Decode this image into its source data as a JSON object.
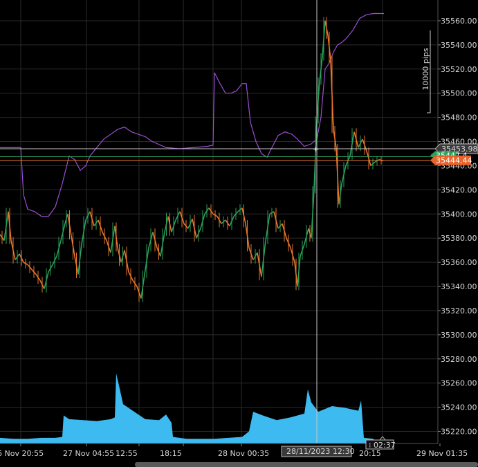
{
  "chart_data": {
    "type": "candlestick",
    "xlabel": "",
    "ylabel": "",
    "ylim": [
      35210,
      35572
    ],
    "y_ticks": [
      35220,
      35240,
      35260,
      35280,
      35300,
      35320,
      35340,
      35360,
      35380,
      35400,
      35420,
      35440,
      35460,
      35480,
      35500,
      35520,
      35540,
      35560
    ],
    "y_tick_labels": [
      "35220.00",
      "35240.00",
      "35260.00",
      "35280.00",
      "35300.00",
      "35320.00",
      "35340.00",
      "35360.00",
      "35380.00",
      "35400.00",
      "35420.00",
      "35440.00",
      "35460.00",
      "35480.00",
      "35500.00",
      "35520.00",
      "35540.00",
      "35560.00"
    ],
    "x_tick_labels": [
      "6 Nov 20:55",
      "27 Nov 04:55",
      "12:55",
      "18:15",
      "28 Nov 00:35",
      "20:15",
      "29 Nov 01:35"
    ],
    "crosshair": {
      "time_label": "28/11/2023 12:30",
      "price_label": "35453.98",
      "price": 35453.98
    },
    "current_price": {
      "label": "35444.44",
      "value": 35444.44,
      "color": "#e8622a"
    },
    "bid_label_partial": "35447.4",
    "scale_label": "10000 pips",
    "timer_label": "02:37",
    "colors": {
      "up": "#2aa15a",
      "down": "#e8762d",
      "indicator": "#9b4fd3",
      "volume": "#3dbaf0",
      "grid": "#2a2a2a",
      "crosshair": "#c8c8c8",
      "bid_line": "#2aa15a"
    },
    "price_path": [
      [
        0,
        35383
      ],
      [
        6,
        35378
      ],
      [
        12,
        35402
      ],
      [
        16,
        35378
      ],
      [
        22,
        35362
      ],
      [
        28,
        35367
      ],
      [
        34,
        35360
      ],
      [
        40,
        35358
      ],
      [
        46,
        35354
      ],
      [
        52,
        35350
      ],
      [
        58,
        35345
      ],
      [
        64,
        35338
      ],
      [
        70,
        35352
      ],
      [
        76,
        35358
      ],
      [
        82,
        35365
      ],
      [
        88,
        35378
      ],
      [
        94,
        35392
      ],
      [
        98,
        35400
      ],
      [
        103,
        35382
      ],
      [
        108,
        35365
      ],
      [
        113,
        35350
      ],
      [
        118,
        35375
      ],
      [
        124,
        35395
      ],
      [
        130,
        35402
      ],
      [
        136,
        35390
      ],
      [
        142,
        35395
      ],
      [
        148,
        35385
      ],
      [
        154,
        35378
      ],
      [
        160,
        35368
      ],
      [
        166,
        35390
      ],
      [
        170,
        35372
      ],
      [
        175,
        35360
      ],
      [
        180,
        35370
      ],
      [
        186,
        35352
      ],
      [
        192,
        35345
      ],
      [
        198,
        35340
      ],
      [
        204,
        35330
      ],
      [
        209,
        35350
      ],
      [
        215,
        35372
      ],
      [
        221,
        35385
      ],
      [
        227,
        35372
      ],
      [
        232,
        35365
      ],
      [
        238,
        35385
      ],
      [
        243,
        35398
      ],
      [
        248,
        35385
      ],
      [
        254,
        35395
      ],
      [
        260,
        35402
      ],
      [
        266,
        35392
      ],
      [
        272,
        35388
      ],
      [
        278,
        35396
      ],
      [
        284,
        35380
      ],
      [
        290,
        35388
      ],
      [
        296,
        35400
      ],
      [
        302,
        35405
      ],
      [
        308,
        35400
      ],
      [
        314,
        35398
      ],
      [
        320,
        35392
      ],
      [
        326,
        35395
      ],
      [
        332,
        35390
      ],
      [
        338,
        35398
      ],
      [
        344,
        35402
      ],
      [
        350,
        35405
      ],
      [
        355,
        35392
      ],
      [
        360,
        35372
      ],
      [
        366,
        35362
      ],
      [
        372,
        35368
      ],
      [
        378,
        35348
      ],
      [
        384,
        35378
      ],
      [
        390,
        35400
      ],
      [
        396,
        35402
      ],
      [
        402,
        35388
      ],
      [
        408,
        35392
      ],
      [
        414,
        35380
      ],
      [
        420,
        35372
      ],
      [
        426,
        35360
      ],
      [
        430,
        35340
      ],
      [
        434,
        35365
      ],
      [
        440,
        35375
      ],
      [
        446,
        35388
      ],
      [
        450,
        35380
      ],
      [
        454,
        35420
      ],
      [
        458,
        35478
      ],
      [
        462,
        35510
      ],
      [
        466,
        35530
      ],
      [
        470,
        35560
      ],
      [
        474,
        35548
      ],
      [
        478,
        35528
      ],
      [
        482,
        35470
      ],
      [
        486,
        35455
      ],
      [
        490,
        35408
      ],
      [
        494,
        35425
      ],
      [
        500,
        35440
      ],
      [
        506,
        35448
      ],
      [
        512,
        35468
      ],
      [
        518,
        35455
      ],
      [
        524,
        35462
      ],
      [
        530,
        35452
      ],
      [
        536,
        35440
      ],
      [
        542,
        35443
      ],
      [
        548,
        35445
      ],
      [
        554,
        35444
      ]
    ],
    "indicator_path": [
      [
        0,
        35455
      ],
      [
        30,
        35455
      ],
      [
        34,
        35416
      ],
      [
        40,
        35404
      ],
      [
        50,
        35402
      ],
      [
        60,
        35398
      ],
      [
        70,
        35398
      ],
      [
        80,
        35406
      ],
      [
        90,
        35425
      ],
      [
        100,
        35448
      ],
      [
        108,
        35445
      ],
      [
        116,
        35436
      ],
      [
        124,
        35440
      ],
      [
        130,
        35448
      ],
      [
        140,
        35455
      ],
      [
        150,
        35462
      ],
      [
        160,
        35466
      ],
      [
        170,
        35470
      ],
      [
        180,
        35472
      ],
      [
        190,
        35468
      ],
      [
        200,
        35466
      ],
      [
        210,
        35464
      ],
      [
        220,
        35460
      ],
      [
        240,
        35455
      ],
      [
        260,
        35454
      ],
      [
        280,
        35455
      ],
      [
        300,
        35456
      ],
      [
        308,
        35457
      ],
      [
        310,
        35517
      ],
      [
        318,
        35508
      ],
      [
        326,
        35500
      ],
      [
        334,
        35500
      ],
      [
        342,
        35502
      ],
      [
        350,
        35508
      ],
      [
        356,
        35508
      ],
      [
        362,
        35476
      ],
      [
        370,
        35460
      ],
      [
        378,
        35450
      ],
      [
        386,
        35447
      ],
      [
        394,
        35456
      ],
      [
        402,
        35465
      ],
      [
        412,
        35468
      ],
      [
        422,
        35466
      ],
      [
        430,
        35462
      ],
      [
        440,
        35456
      ],
      [
        450,
        35458
      ],
      [
        458,
        35462
      ],
      [
        464,
        35480
      ],
      [
        470,
        35520
      ],
      [
        476,
        35525
      ],
      [
        482,
        35534
      ],
      [
        488,
        35540
      ],
      [
        494,
        35542
      ],
      [
        500,
        35545
      ],
      [
        510,
        35552
      ],
      [
        520,
        35562
      ],
      [
        530,
        35565
      ],
      [
        540,
        35566
      ],
      [
        555,
        35566
      ]
    ],
    "volume_path": [
      [
        0,
        0.06
      ],
      [
        20,
        0.05
      ],
      [
        40,
        0.05
      ],
      [
        60,
        0.06
      ],
      [
        80,
        0.06
      ],
      [
        90,
        0.07
      ],
      [
        92,
        0.3
      ],
      [
        100,
        0.26
      ],
      [
        120,
        0.25
      ],
      [
        140,
        0.24
      ],
      [
        160,
        0.26
      ],
      [
        166,
        0.28
      ],
      [
        168,
        0.75
      ],
      [
        172,
        0.62
      ],
      [
        178,
        0.42
      ],
      [
        190,
        0.36
      ],
      [
        210,
        0.26
      ],
      [
        230,
        0.25
      ],
      [
        240,
        0.31
      ],
      [
        248,
        0.22
      ],
      [
        250,
        0.07
      ],
      [
        270,
        0.05
      ],
      [
        290,
        0.05
      ],
      [
        310,
        0.05
      ],
      [
        330,
        0.06
      ],
      [
        350,
        0.07
      ],
      [
        360,
        0.13
      ],
      [
        366,
        0.34
      ],
      [
        380,
        0.3
      ],
      [
        400,
        0.25
      ],
      [
        420,
        0.28
      ],
      [
        440,
        0.32
      ],
      [
        445,
        0.58
      ],
      [
        450,
        0.44
      ],
      [
        460,
        0.34
      ],
      [
        480,
        0.4
      ],
      [
        500,
        0.38
      ],
      [
        518,
        0.35
      ],
      [
        522,
        0.46
      ],
      [
        526,
        0.06
      ],
      [
        540,
        0.05
      ]
    ],
    "volume_band": {
      "bottom": 641,
      "max_height": 135
    }
  }
}
